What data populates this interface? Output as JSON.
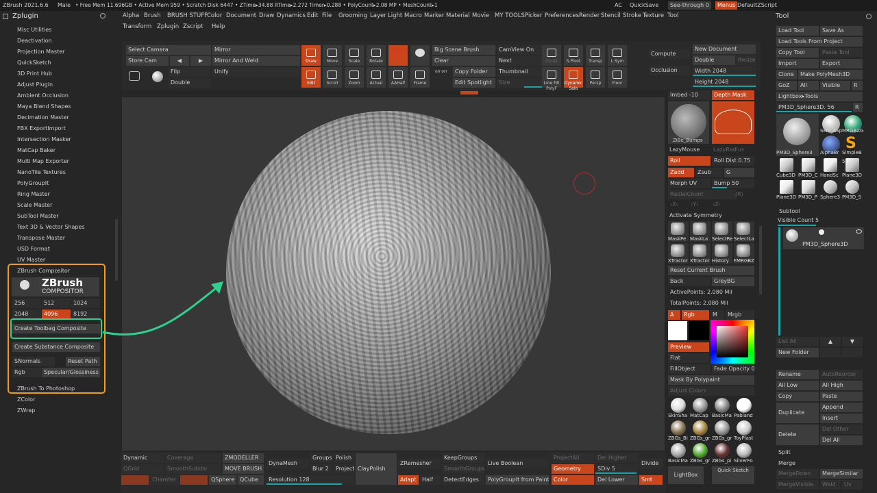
{
  "topbar": {
    "app": "ZBrush 2021.6.6",
    "user": "Male",
    "stats": "• Free Mem 11.696GB • Active Mem 959 • Scratch Disk 6447 • ZTime▸34.88 RTime▸2.272 Timer▸0.288 • PolyCount▸2.08 MP • MeshCount▸1",
    "ac": "AC",
    "quicksave": "QuickSave",
    "seethrough": "See-through 0",
    "menus": "Menus",
    "script": "DefaultZScript"
  },
  "menu_row1": [
    "Alpha",
    "Brush",
    "BRUSH STUFF",
    "Color",
    "Document",
    "Draw",
    "Dynamics",
    "Edit",
    "File",
    "Grooming",
    "Layer",
    "Light",
    "Macro",
    "Marker",
    "Material",
    "Movie",
    "MY TOOLS",
    "Picker",
    "Preferences",
    "Render",
    "Stencil",
    "Stroke",
    "Texture",
    "Tool"
  ],
  "menu_row2": [
    "Transform",
    "Zplugin",
    "Zscript",
    "Help"
  ],
  "left": {
    "title": "Zplugin",
    "items": [
      "Misc Utilities",
      "Deactivation",
      "Projection Master",
      "QuickSketch",
      "3D Print Hub",
      "Adjust Plugin",
      "Ambient Occlusion",
      "Maya Blend Shapes",
      "Decimation Master",
      "FBX ExportImport",
      "Intersection Masker",
      "MatCap Baker",
      "Multi Map Exporter",
      "NanoTile Textures",
      "PolyGroupIt",
      "Ring Master",
      "Scale Master",
      "SubTool Master",
      "Text 3D & Vector Shapes",
      "Transpose Master",
      "USD Format",
      "UV Master"
    ],
    "comp_title": "ZBrush Compositor",
    "logo_main": "ZBrush",
    "logo_sub": "COMPOSITOR",
    "res": [
      "256",
      "512",
      "1024",
      "2048",
      "4096",
      "8192"
    ],
    "toolbag": "Create Toolbag Composite",
    "substance": "Create Substance Composite",
    "snormals": "SNormals",
    "reset_path": "Reset Path",
    "rgb": "Rgb",
    "specular": "Specular/Glossiness",
    "after": [
      "ZBrush To Photoshop",
      "ZColor",
      "ZWrap"
    ]
  },
  "shelf": {
    "select_camera": "Select Camera",
    "store_cam": "Store Cam",
    "mirror": "Mirror",
    "mirror_weld": "Mirror And Weld",
    "flip": "Flip",
    "unify": "Unify",
    "double": "Double",
    "draw": "Draw",
    "edit": "Edit",
    "move": "Move",
    "scale": "Scale",
    "rotate": "Rotate",
    "scroll": "Scroll",
    "zoom": "Zoom",
    "actual": "Actual",
    "aahalf": "AAHalf",
    "frame": "Frame",
    "big_scene": "Big Scene Brush",
    "clear": "Clear",
    "copy_folder": "Copy Folder",
    "edit_spotlight": "Edit Spotlight",
    "onoff": "on·orr",
    "camview": "CamView On",
    "next": "Next",
    "thumbnail": "Thumbnail",
    "size": "Size",
    "ghost": "Ghost",
    "spivot": "S.Pivot",
    "transp": "Transp",
    "lsym": "L.Sym",
    "polyf": "Line Fill PolyF",
    "dynamic": "Dynamic Solo",
    "persp": "Persp",
    "floor": "Floor",
    "compute": "Compute",
    "occlusion": "Occlusion",
    "new_doc": "New Document",
    "double2": "Double",
    "resize": "Resize",
    "width": "Width 2048",
    "height": "Height 2048"
  },
  "right": {
    "imbed": "Imbed -10",
    "depth_mask": "Depth Mask",
    "zibe": "ZiBe_Bumps",
    "lazymouse": "LazyMouse",
    "lazyradius": "LazyRadius",
    "roll": "Roll",
    "roll_dist": "Roll Dist 0.75",
    "zadd": "Zadd",
    "zsub": "Zsub",
    "g": "G",
    "morph_uv": "Morph UV",
    "bump": "Bump 50",
    "radialcount": "RadialCount",
    "r1": "(R)",
    "xyz": [
      "›X‹",
      "›Y‹",
      "›Z‹"
    ],
    "activate_sym": "Activate Symmetry",
    "brushes": [
      "MaskPe",
      "MaskLa",
      "SelectRe",
      "SelectLa",
      "XTractor",
      "XTractor",
      "History",
      "FMRGBZG"
    ],
    "reset_brush": "Reset Current Brush",
    "back": "Back",
    "greybg": "GreyBG",
    "active_points": "ActivePoints: 2.080 Mil",
    "total_points": "TotalPoints: 2.080 Mil",
    "a": "A",
    "rgb": "Rgb",
    "m": "M",
    "mrgb": "Mrgb",
    "preview": "Preview",
    "flat": "Flat",
    "fillobject": "FillObject",
    "fade": "Fade Opacity 0",
    "mask_poly": "Mask By Polypaint",
    "adjust_colors": "Adjust Colors",
    "materials": [
      "SkinSha",
      "MatCap",
      "BasicMa",
      "Pabland",
      "ZBGs_Bi",
      "ZBGs_gr",
      "ZBGs_gr",
      "ToyPlast",
      "BasicMa",
      "ZBGs_gr",
      "ZBGs_pi",
      "SilverFo"
    ],
    "lightbox": "LightBox",
    "quick_sketch": "Quick Sketch"
  },
  "tool": {
    "title": "Tool",
    "load_tool": "Load Tool",
    "save_as": "Save As",
    "load_project": "Load Tools From Project",
    "copy_tool": "Copy Tool",
    "paste_tool": "Paste Tool",
    "import": "Import",
    "export": "Export",
    "clone": "Clone",
    "make_poly": "Make PolyMesh3D",
    "goz": "GoZ",
    "all": "All",
    "visible": "Visible",
    "r": "R",
    "lightbox_tools": "Lightbox▸Tools",
    "current": "PM3D_Sphere3D. 56",
    "r2": "R",
    "thumbs": [
      "PM3D_Sphere3",
      "Skin_ZSp",
      "MRGBZG",
      "AlphaBr",
      "SimpleB",
      "Cube3D",
      "PM3D_C",
      "HandSc",
      "Plane3D",
      "Plane3D",
      "PM3D_P",
      "Sphere3",
      "PM3D_S"
    ],
    "thumb_count": "2",
    "thumb_count2": "5",
    "subtool": "Subtool",
    "visible_count": "Visible Count 5",
    "subtool_name": "PM3D_Sphere3D",
    "list_all": "List All",
    "new_folder": "New Folder",
    "rename": "Rename",
    "autoreorder": "AutoReorder",
    "all_low": "All Low",
    "all_high": "All High",
    "copy": "Copy",
    "paste": "Paste",
    "duplicate": "Duplicate",
    "append": "Append",
    "insert": "Insert",
    "delete": "Delete",
    "del_other": "Del Other",
    "del_all": "Del All",
    "split": "Split",
    "merge": "Merge",
    "mergedown": "MergeDown",
    "mergesimilar": "MergeSimilar",
    "mergevisible": "MergeVisible",
    "weld": "Weld",
    "uv": "Uv"
  },
  "bottom": {
    "dynamic": "Dynamic",
    "coverage": "Coverage",
    "qgrid": "QGrid",
    "smoothsubdiv": "SmoothSubdiv",
    "chamfer": "Chamfer",
    "zmodeller": "ZMODELLER",
    "move_brush": "MOVE BRUSH",
    "qsphere": "QSphere",
    "qcube": "QCube",
    "dynamesh": "DynaMesh",
    "groups": "Groups",
    "polish": "Polish",
    "blur": "Blur 2",
    "project": "Project",
    "resolution": "Resolution 128",
    "claypolish": "ClayPolish",
    "zremesher": "ZRemesher",
    "adapt": "Adapt",
    "half": "Half",
    "keepgroups": "KeepGroups",
    "smoothgroups": "SmoothGroups",
    "detectedges": "DetectEdges",
    "live_boolean": "Live Boolean",
    "polygroupit": "PolyGroupIt from Paint",
    "projectall": "ProjectAll",
    "del_higher": "Del Higher",
    "geometry": "Geometry",
    "sdiv": "SDiv 5",
    "color": "Color",
    "del_lower": "Del Lower",
    "divide": "Divide",
    "smt": "Smt"
  },
  "colors": {
    "accent_orange": "#c9451b",
    "highlight_orange": "#f39c1a",
    "highlight_green": "#2ed28e",
    "slider": "#18a6a6"
  }
}
